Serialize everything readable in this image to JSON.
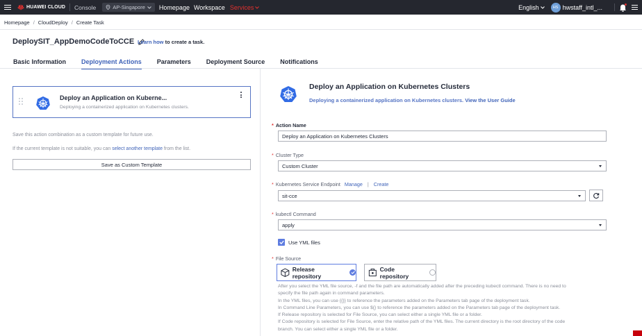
{
  "topbar": {
    "logo_text": "HUAWEI CLOUD",
    "console": "Console",
    "region": "AP-Singapore",
    "homepage": "Homepage",
    "workspace": "Workspace",
    "service": "Services",
    "language": "English",
    "avatar_initials": "HS",
    "username": "hwstaff_intl_...",
    "brand_color": "#c7000b",
    "accent_color": "#5e7ce0"
  },
  "breadcrumb": [
    "Homepage",
    "CloudDeploy",
    "Create Task"
  ],
  "page": {
    "title": "DeploySIT_AppDemoCodeToCCE",
    "learn_link": "Learn how",
    "learn_suffix": "to create a task."
  },
  "tabs": [
    "Basic Information",
    "Deployment Actions",
    "Parameters",
    "Deployment Source",
    "Notifications"
  ],
  "active_tab": "Deployment Actions",
  "left": {
    "card_title": "Deploy an Application on Kuberne...",
    "card_desc": "Deploying a containerized application on Kubernetes clusters.",
    "hint1": "Save this action combination as a custom template for future use.",
    "hint2_prefix": "If the current template is not suitable, you can",
    "hint2_link": "select another template",
    "hint2_suffix": "from the list.",
    "save_button": "Save as Custom Template"
  },
  "right": {
    "title": "Deploy an Application on Kubernetes Clusters",
    "desc": "Deploying a containerized application on Kubernetes clusters.",
    "guide_link": "View the User Guide",
    "action_name_label": "Action Name",
    "action_name_value": "Deploy an Application on Kubernetes Clusters",
    "cluster_type_label": "Cluster Type",
    "cluster_type_value": "Custom Cluster",
    "endpoint_label": "Kubernetes Service Endpoint",
    "endpoint_manage": "Manage",
    "endpoint_pipe": "|",
    "endpoint_create": "Create",
    "endpoint_value": "sit-cce",
    "kubectl_label": "kubectl Command",
    "kubectl_value": "apply",
    "use_yml_label": "Use YML files",
    "file_source_label": "File Source",
    "release_repo": "Release repository",
    "code_repo": "Code repository",
    "help_lines": [
      "After you select the YML file source, -f and the file path are automatically added after the preceding kubectl command. There is no need to",
      "specify the file path again in command parameters.",
      "In the YML files, you can use {{}} to reference the parameters added on the Parameters tab page of the deployment task.",
      "In Command Line Parameters, you can use ${} to reference the parameters added on the Parameters tab page of the deployment task.",
      "If Release repository is selected for File Source, you can select either a single YML file or a folder.",
      "If Code repository is selected for File Source, enter the relative path of the YML files. The current directory is the root directory of the code",
      "branch. You can select either a single YML file or a folder."
    ]
  }
}
